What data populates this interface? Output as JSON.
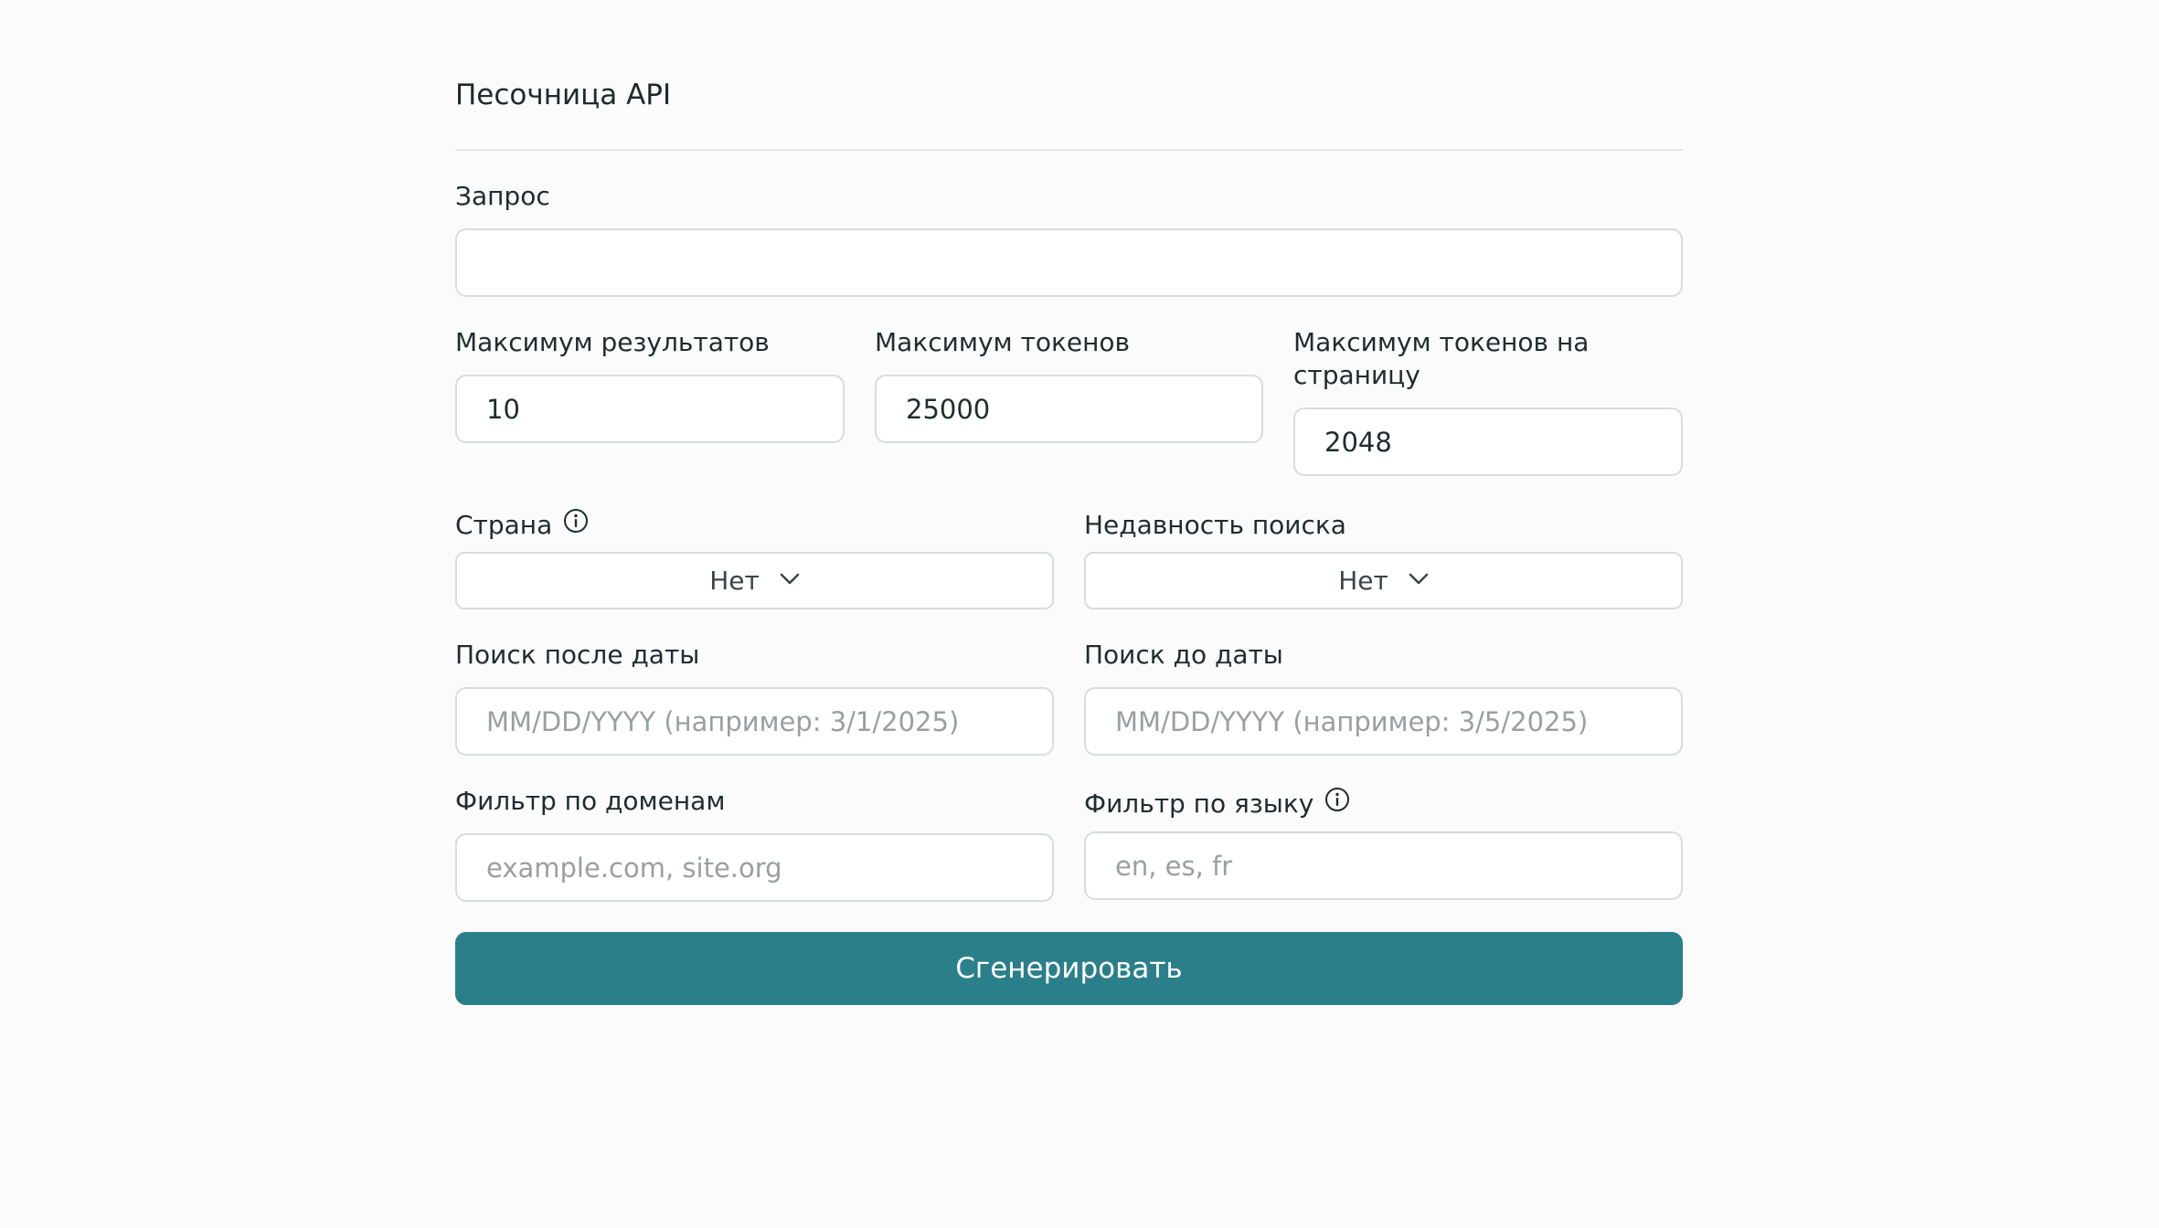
{
  "header": {
    "title": "Песочница API"
  },
  "form": {
    "query": {
      "label": "Запрос",
      "value": "",
      "placeholder": ""
    },
    "max_results": {
      "label": "Максимум результатов",
      "value": "10"
    },
    "max_tokens": {
      "label": "Максимум токенов",
      "value": "25000"
    },
    "max_tokens_per_page": {
      "label": "Максимум токенов на страницу",
      "value": "2048"
    },
    "country": {
      "label": "Страна",
      "info_icon": "info-icon",
      "selected": "Нет"
    },
    "search_recency": {
      "label": "Недавность поиска",
      "selected": "Нет"
    },
    "search_after_date": {
      "label": "Поиск после даты",
      "value": "",
      "placeholder": "MM/DD/YYYY (например: 3/1/2025)"
    },
    "search_before_date": {
      "label": "Поиск до даты",
      "value": "",
      "placeholder": "MM/DD/YYYY (например: 3/5/2025)"
    },
    "domain_filter": {
      "label": "Фильтр по доменам",
      "value": "",
      "placeholder": "example.com, site.org"
    },
    "language_filter": {
      "label": "Фильтр по языку",
      "info_icon": "info-icon",
      "value": "",
      "placeholder": "en, es, fr"
    },
    "submit_label": "Сгенерировать"
  },
  "colors": {
    "accent": "#2a7f8a",
    "background": "#fbfbfb",
    "border": "#d9dcdc",
    "placeholder": "#9a9fa0"
  }
}
